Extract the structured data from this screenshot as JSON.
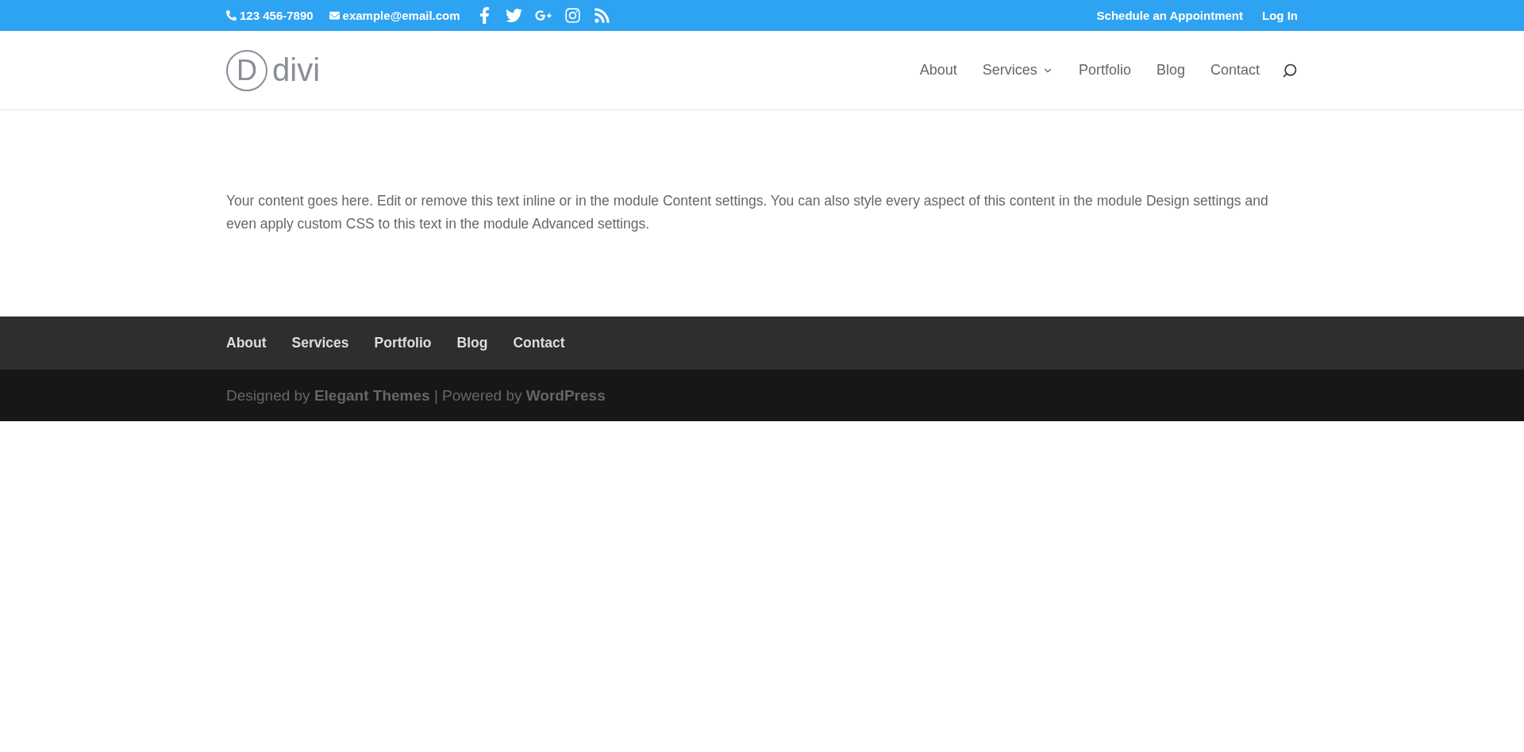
{
  "top_bar": {
    "phone": "123 456-7890",
    "email": "example@email.com",
    "social": [
      {
        "kind": "facebook"
      },
      {
        "kind": "twitter"
      },
      {
        "kind": "google-plus"
      },
      {
        "kind": "instagram"
      },
      {
        "kind": "rss"
      }
    ],
    "links": [
      "Schedule an Appointment",
      "Log In"
    ]
  },
  "header": {
    "logo": {
      "mark": "D",
      "text": "divi"
    },
    "nav": [
      {
        "label": "About",
        "has_dropdown": false
      },
      {
        "label": "Services",
        "has_dropdown": true
      },
      {
        "label": "Portfolio",
        "has_dropdown": false
      },
      {
        "label": "Blog",
        "has_dropdown": false
      },
      {
        "label": "Contact",
        "has_dropdown": false
      }
    ]
  },
  "content": {
    "text": "Your content goes here. Edit or remove this text inline or in the module Content settings. You can also style every aspect of this content in the module Design settings and even apply custom CSS to this text in the module Advanced settings."
  },
  "footer": {
    "nav": [
      "About",
      "Services",
      "Portfolio",
      "Blog",
      "Contact"
    ],
    "credits": "Designed by **Elegant Themes** | Powered by **WordPress**"
  }
}
